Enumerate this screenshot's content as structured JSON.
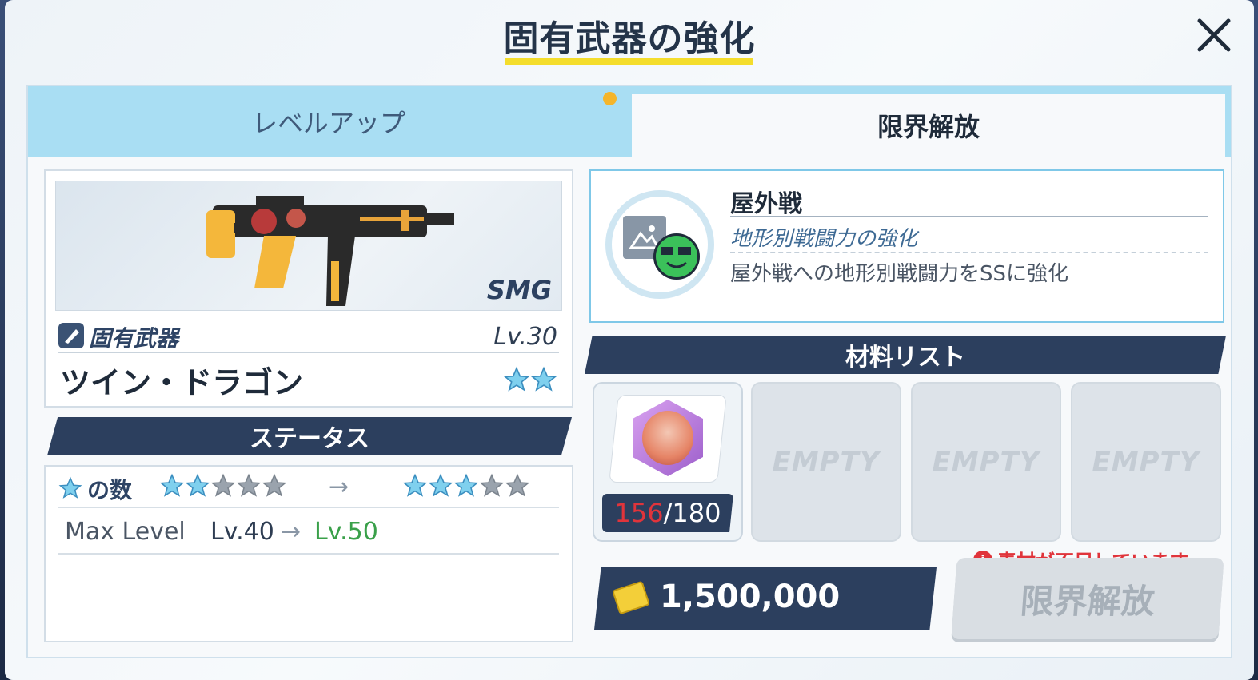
{
  "title": "固有武器の強化",
  "tabs": {
    "level_up": "レベルアップ",
    "limit_break": "限界解放"
  },
  "weapon": {
    "class": "SMG",
    "type_label": "固有武器",
    "level": "Lv.30",
    "name": "ツイン・ドラゴン",
    "stars": 2
  },
  "status": {
    "banner": "ステータス",
    "star_count_label": "の数",
    "stars_before": 2,
    "stars_after": 3,
    "stars_total": 5,
    "arrow": "→",
    "max_level_label": "Max Level",
    "max_level_from": "Lv.40",
    "max_level_to": "Lv.50"
  },
  "skill": {
    "title": "屋外戦",
    "subtitle": "地形別戦闘力の強化",
    "description": "屋外戦への地形別戦闘力をSSに強化"
  },
  "materials": {
    "banner": "材料リスト",
    "item": {
      "have": "156",
      "need": "/180"
    },
    "empty_label": "EMPTY"
  },
  "warning": "素材が不足しています。",
  "cost": "1,500,000",
  "limit_break_button": "限界解放",
  "colors": {
    "navy": "#2c3f5e",
    "tab_active_bg": "#a9def3",
    "underline": "#f4dd2c",
    "warning_red": "#e0343b",
    "level_green": "#3aa04a"
  }
}
